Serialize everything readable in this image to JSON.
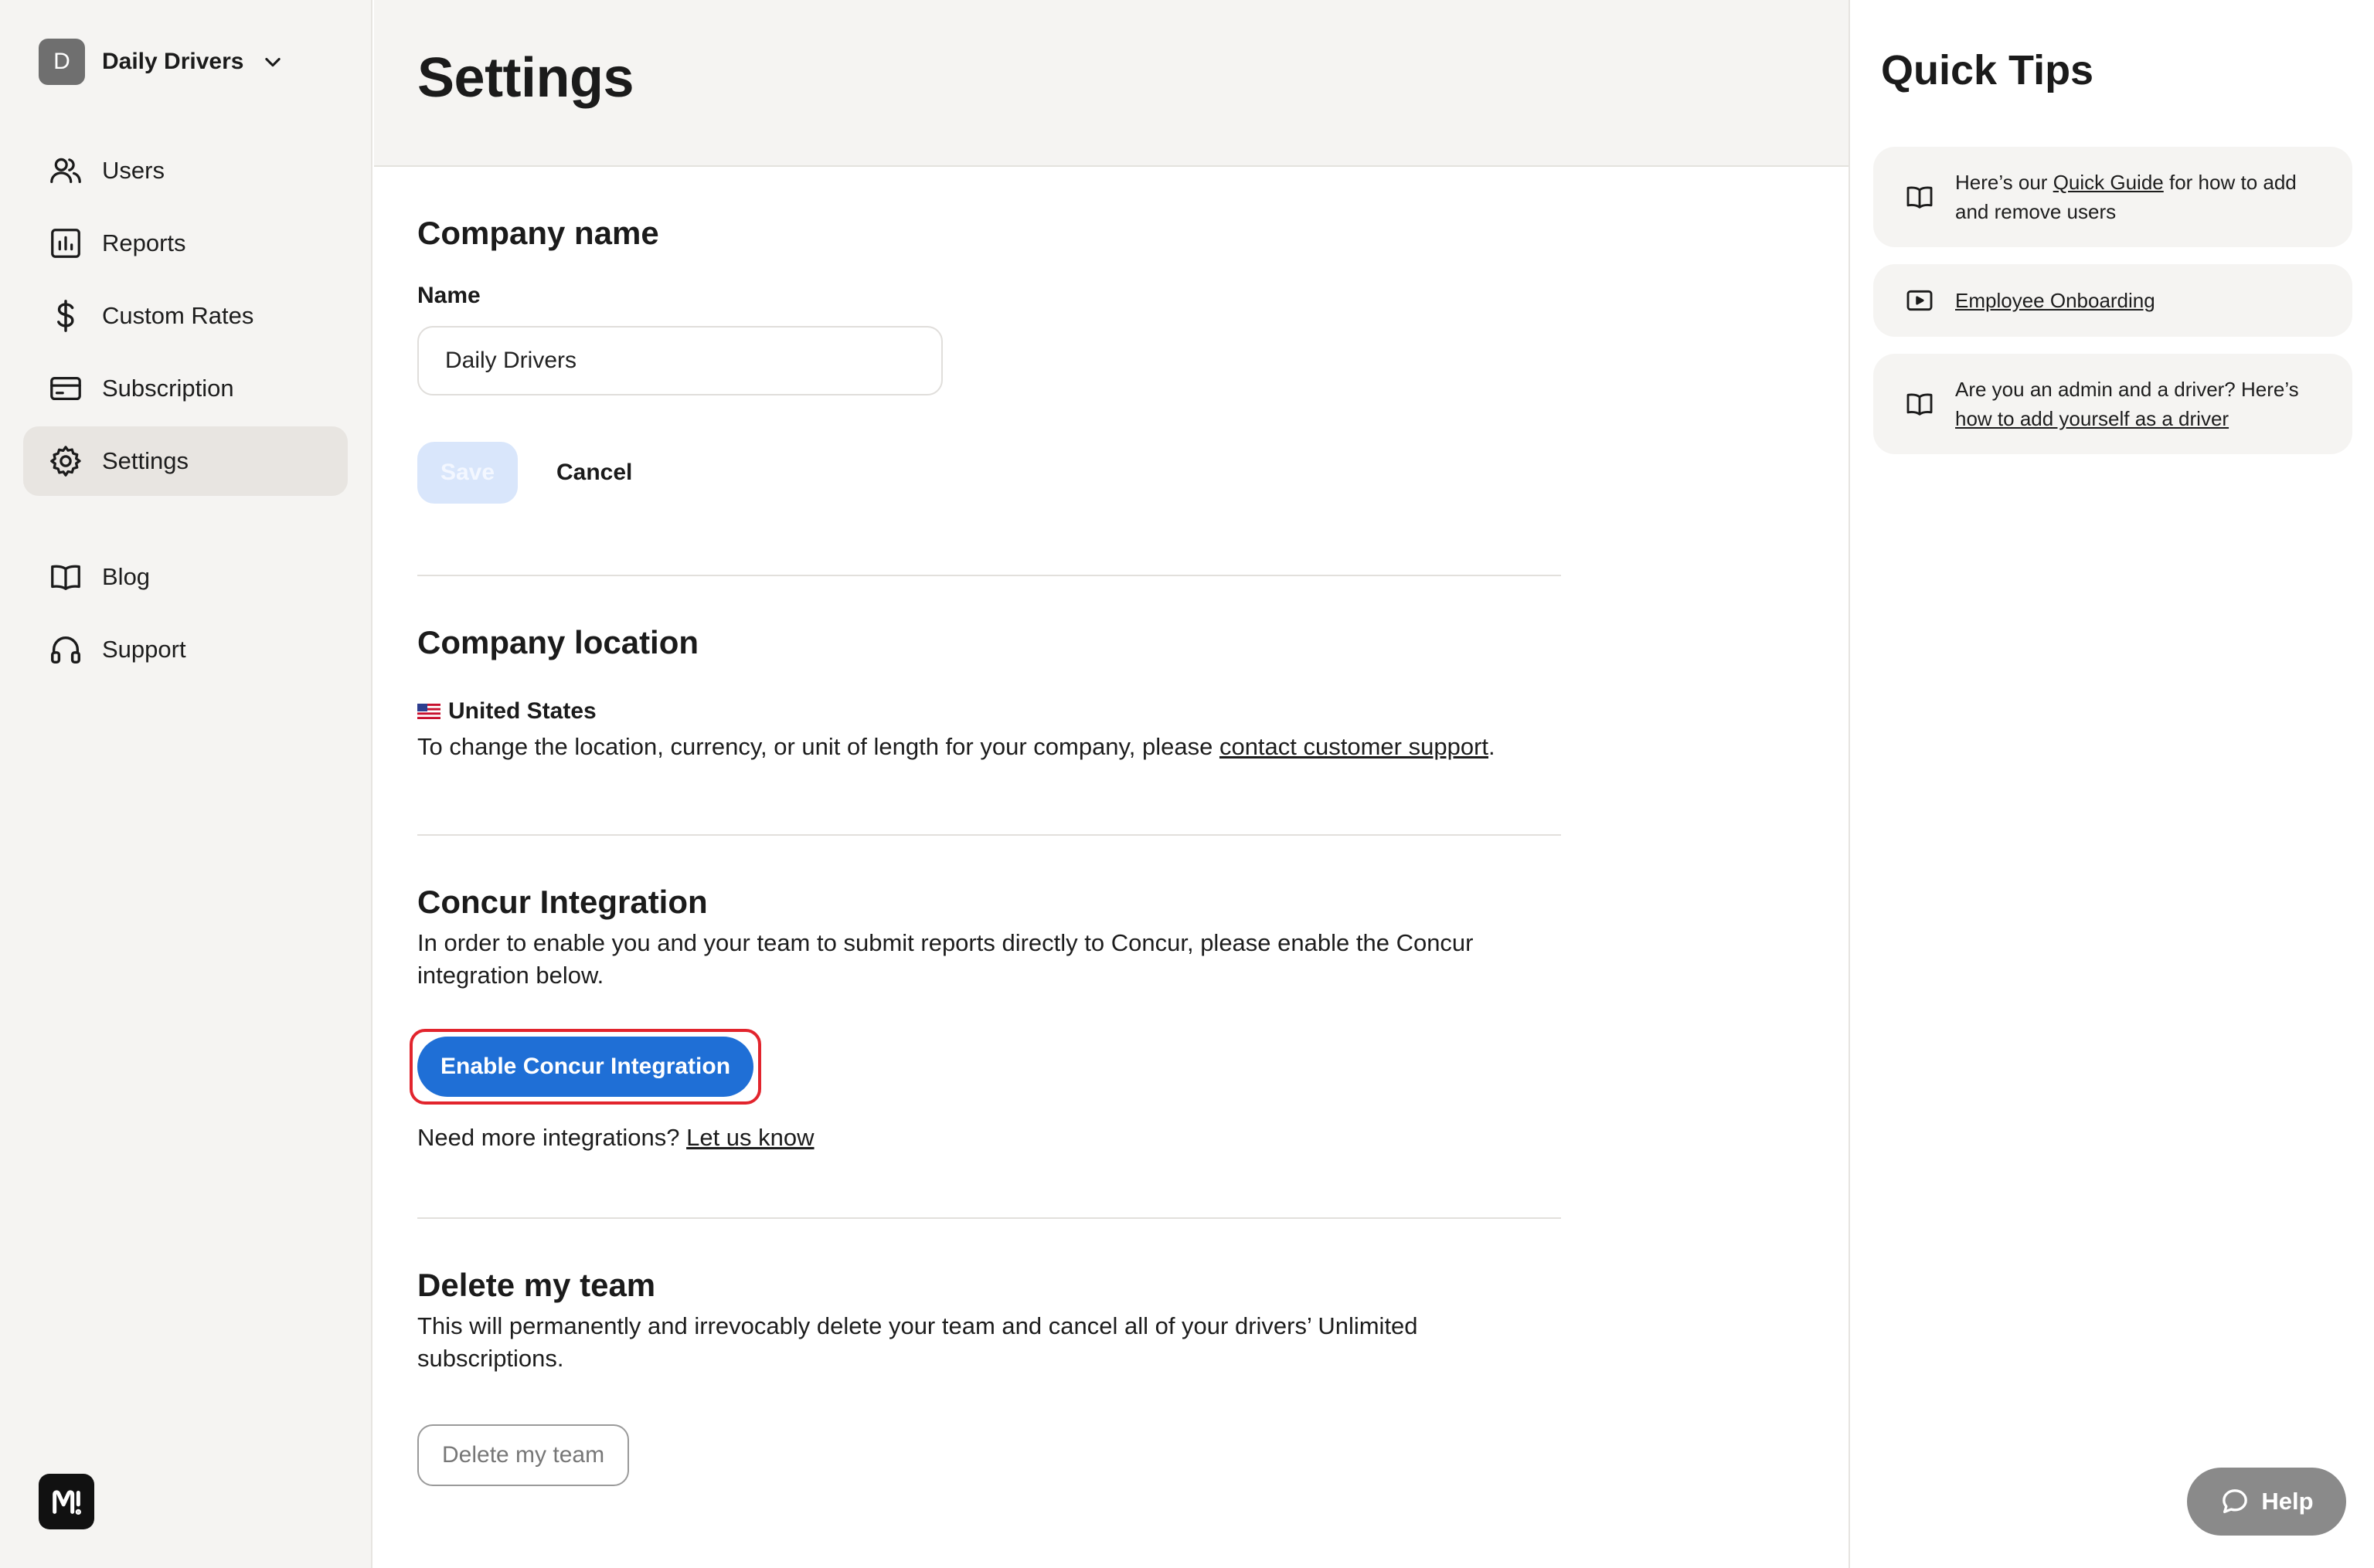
{
  "sidebar": {
    "team": {
      "initial": "D",
      "name": "Daily Drivers"
    },
    "items": [
      {
        "label": "Users",
        "icon": "users-icon"
      },
      {
        "label": "Reports",
        "icon": "chart-icon"
      },
      {
        "label": "Custom Rates",
        "icon": "dollar-icon"
      },
      {
        "label": "Subscription",
        "icon": "credit-card-icon"
      },
      {
        "label": "Settings",
        "icon": "gear-icon",
        "active": true
      }
    ],
    "secondary": [
      {
        "label": "Blog",
        "icon": "book-icon"
      },
      {
        "label": "Support",
        "icon": "headset-icon"
      }
    ]
  },
  "header": {
    "title": "Settings"
  },
  "company_name": {
    "heading": "Company name",
    "label": "Name",
    "value": "Daily Drivers",
    "save_label": "Save",
    "cancel_label": "Cancel"
  },
  "company_location": {
    "heading": "Company location",
    "country": "United States",
    "text_before": "To change the location, currency, or unit of length for your company, please ",
    "link": "contact customer support",
    "text_after": "."
  },
  "concur": {
    "heading": "Concur Integration",
    "description": "In order to enable you and your team to submit reports directly to Concur, please enable the Concur integration below.",
    "button_label": "Enable Concur Integration",
    "more_text": "Need more integrations? ",
    "more_link": "Let us know"
  },
  "delete_team": {
    "heading": "Delete my team",
    "description": "This will permanently and irrevocably delete your team and cancel all of your drivers’ Unlimited subscriptions.",
    "button_label": "Delete my team"
  },
  "quick_tips": {
    "title": "Quick Tips",
    "tip1": {
      "before": "Here’s our ",
      "link": "Quick Guide",
      "after": " for how to add and remove users"
    },
    "tip2": {
      "link": "Employee Onboarding"
    },
    "tip3": {
      "before": "Are you an admin and a driver? Here’s ",
      "link": "how to add yourself as a driver"
    }
  },
  "help": {
    "label": "Help"
  },
  "colors": {
    "primary": "#1f6fd6",
    "highlight": "#e2242d",
    "sidebar_bg": "#f5f4f2"
  }
}
